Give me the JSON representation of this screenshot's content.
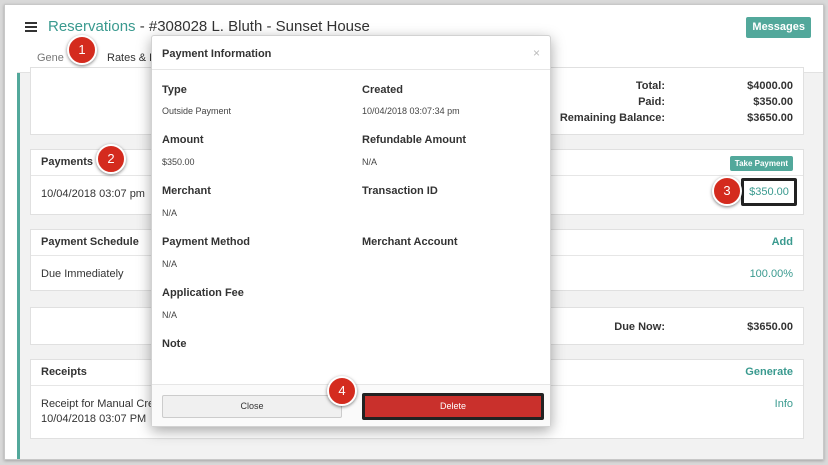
{
  "header": {
    "title_link": "Reservations",
    "title_rest": " - #308028 L. Bluth - Sunset House",
    "messages_label": "Messages"
  },
  "tabs": [
    {
      "label": "Gene"
    },
    {
      "label": "Rates & Fe"
    }
  ],
  "totals": {
    "total_label": "Total:",
    "total_value": "$4000.00",
    "paid_label": "Paid:",
    "paid_value": "$350.00",
    "remaining_label": "Remaining Balance:",
    "remaining_value": "$3650.00"
  },
  "payments": {
    "title": "Payments",
    "take_payment_label": "Take Payment",
    "row_date": "10/04/2018 03:07 pm",
    "row_amount": "$350.00"
  },
  "schedule": {
    "title": "Payment Schedule",
    "add_label": "Add",
    "row_label": "Due Immediately",
    "row_percent": "100.00%"
  },
  "due": {
    "label": "Due Now:",
    "value": "$3650.00"
  },
  "receipts": {
    "title": "Receipts",
    "generate_label": "Generate",
    "row_line1": "Receipt for Manual Cre",
    "row_line2": "10/04/2018 03:07 PM",
    "info_label": "Info"
  },
  "modal": {
    "title": "Payment Information",
    "close_icon": "×",
    "fields": {
      "type_label": "Type",
      "type_value": "Outside Payment",
      "created_label": "Created",
      "created_value": "10/04/2018 03:07:34 pm",
      "amount_label": "Amount",
      "amount_value": "$350.00",
      "refundable_label": "Refundable Amount",
      "refundable_value": "N/A",
      "merchant_label": "Merchant",
      "merchant_value": "N/A",
      "transaction_label": "Transaction ID",
      "method_label": "Payment Method",
      "method_value": "N/A",
      "merchant_account_label": "Merchant Account",
      "app_fee_label": "Application Fee",
      "app_fee_value": "N/A",
      "note_label": "Note"
    },
    "close_button": "Close",
    "delete_button": "Delete"
  },
  "badges": [
    "1",
    "2",
    "3",
    "4"
  ],
  "icons": {
    "menu": "hamburger-icon",
    "close": "close-icon"
  },
  "colors": {
    "accent": "#3a9a8f",
    "danger": "#c9302c",
    "badge": "#d42b1e"
  }
}
